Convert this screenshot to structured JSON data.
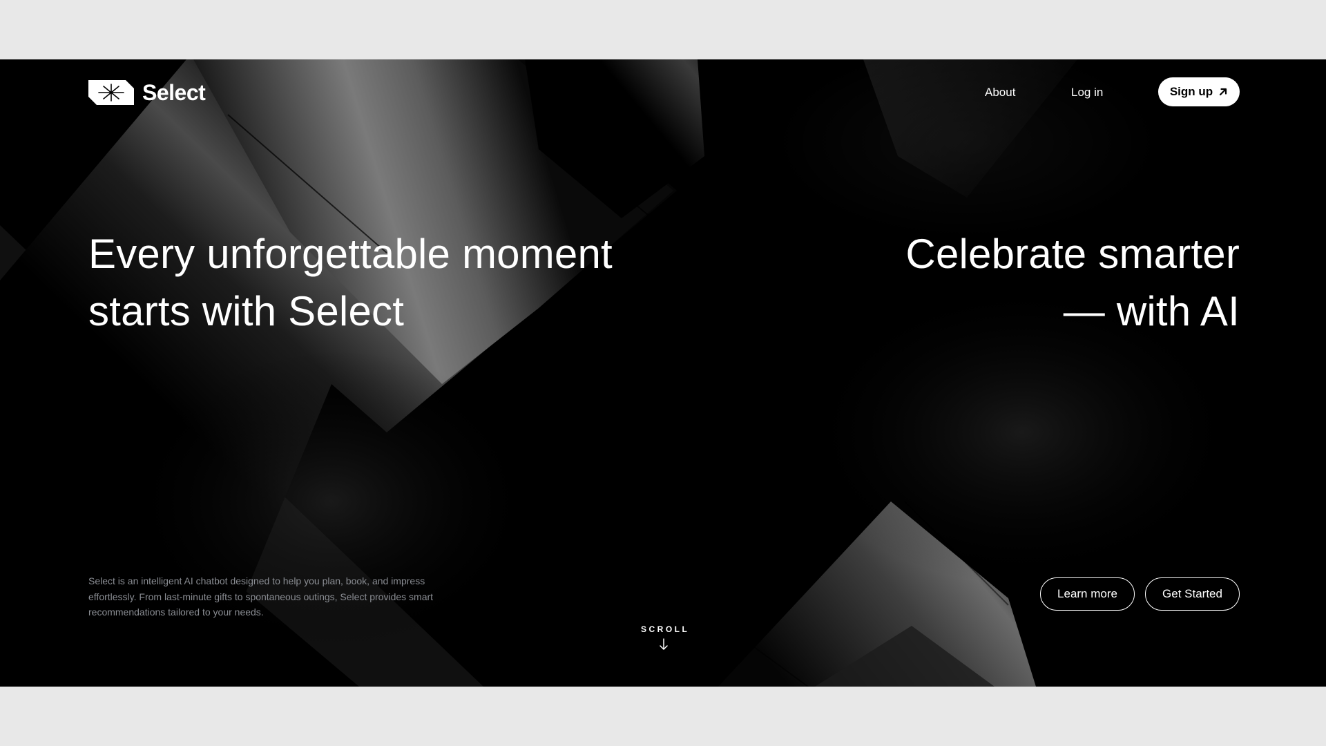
{
  "brand": {
    "name": "Select",
    "logo_icon": "asterisk-badge-icon"
  },
  "nav": {
    "about": "About",
    "login": "Log in",
    "signup": "Sign up",
    "signup_icon": "arrow-up-right-icon"
  },
  "hero": {
    "left_line1": "Every unforgettable moment",
    "left_line2": "starts with Select",
    "right_line1": "Celebrate smarter",
    "right_line2": "— with AI"
  },
  "description": "Select is an intelligent AI chatbot designed to help you plan, book, and impress effortlessly. From last-minute gifts to spontaneous outings, Select provides smart recommendations tailored to your needs.",
  "scroll": {
    "label": "SCROLL",
    "icon": "arrow-down-icon"
  },
  "actions": {
    "learn_more": "Learn more",
    "get_started": "Get Started"
  },
  "colors": {
    "background": "#000000",
    "page": "#e8e8e8",
    "text": "#ffffff",
    "muted_text": "#8a8d93"
  }
}
